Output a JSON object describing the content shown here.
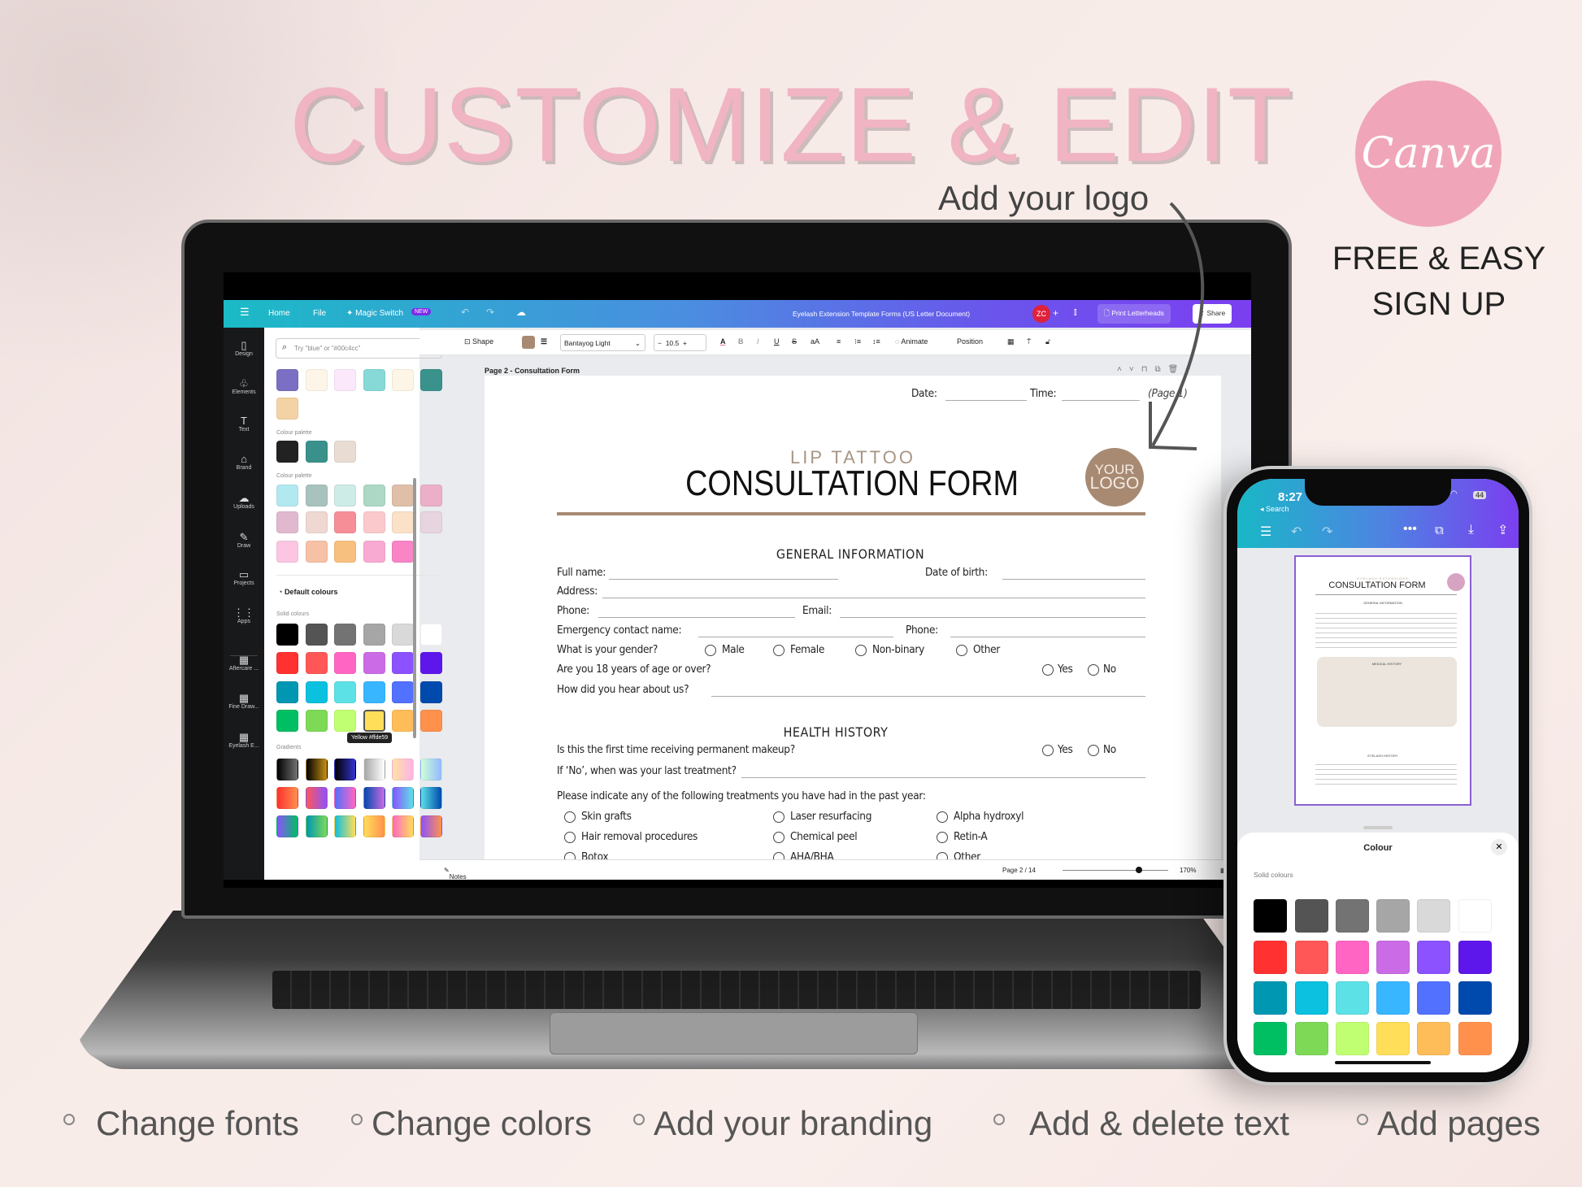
{
  "hero": {
    "title": "CUSTOMIZE & EDIT",
    "add_logo": "Add your logo",
    "canva_logo": "Canva",
    "free_line1": "FREE & EASY",
    "free_line2": "SIGN UP"
  },
  "features": [
    "Change fonts",
    "Change colors",
    "Add your branding",
    "Add & delete text",
    "Add pages"
  ],
  "canva": {
    "topbar": {
      "menu_icon": "hamburger-icon",
      "home": "Home",
      "file": "File",
      "magic_switch": "Magic Switch",
      "new_badge": "NEW",
      "doc_title": "Eyelash Extension Template Forms (US Letter Document)",
      "avatar": "ZC",
      "avatar_color": "#e0213a",
      "print": "Print Letterheads",
      "share": "Share"
    },
    "nav": [
      {
        "label": "Design",
        "icon": "▯"
      },
      {
        "label": "Elements",
        "icon": "♧"
      },
      {
        "label": "Text",
        "icon": "T"
      },
      {
        "label": "Brand",
        "icon": "⌂"
      },
      {
        "label": "Uploads",
        "icon": "☁"
      },
      {
        "label": "Draw",
        "icon": "✎"
      },
      {
        "label": "Projects",
        "icon": "▭"
      },
      {
        "label": "Apps",
        "icon": "⋮⋮"
      },
      {
        "label": "Aftercare ...",
        "icon": "▦"
      },
      {
        "label": "Fine Draw...",
        "icon": "▦"
      },
      {
        "label": "Eyelash E...",
        "icon": "▦"
      }
    ],
    "panel": {
      "search_placeholder": "Try \"blue\" or \"#00c4cc\"",
      "pastel": [
        "#7b6fc4",
        "#fdf6e8",
        "#fce8fb",
        "#86d9d7",
        "#fdf6e6",
        "#3a928c",
        "#f3d3a3"
      ],
      "palette_label": "Colour palette",
      "palette1": [
        "#222222",
        "#3a918c",
        "#e9dcd2"
      ],
      "palette2": [
        "#b2e8ef",
        "#a8c3bd",
        "#cdebe7",
        "#acd8c5",
        "#dfbfa8",
        "#ecafc8",
        "#e0b9cf",
        "#efd7d2",
        "#f68e98",
        "#fbc9cc",
        "#fae1c7",
        "#e6d5df",
        "#fcc6e2",
        "#f7c1a5",
        "#f8c07e",
        "#f9aad3",
        "#f985c7"
      ],
      "default_colours": "Default colours",
      "solid_label": "Solid colours",
      "solid": [
        "#000000",
        "#545454",
        "#737373",
        "#a6a6a6",
        "#d9d9d9",
        "#ffffff",
        "#ff3131",
        "#ff5757",
        "#ff66c4",
        "#cb6ce6",
        "#8c52ff",
        "#5e17eb",
        "#0097b2",
        "#0cc0df",
        "#5ce1e6",
        "#38b6ff",
        "#5271ff",
        "#004aad",
        "#00bf63",
        "#7ed957",
        "#c1ff72",
        "#ffde59",
        "#ffbd59",
        "#ff914d"
      ],
      "selected_solid": "#ffde59",
      "tooltip": "Yellow #ffde59",
      "gradients_label": "Gradients",
      "gradients": [
        [
          "#000000",
          "#737373"
        ],
        [
          "#000000",
          "#c89116"
        ],
        [
          "#000000",
          "#3533cd"
        ],
        [
          "#a6a6a6",
          "#ffffff"
        ],
        [
          "#ffe3a3",
          "#fdb2e8"
        ],
        [
          "#cdffd8",
          "#94b9ff"
        ],
        [
          "#ff3131",
          "#ff914d"
        ],
        [
          "#ff5757",
          "#8c52ff"
        ],
        [
          "#5170ff",
          "#ff66c4"
        ],
        [
          "#004aad",
          "#cb6ce6"
        ],
        [
          "#8c52ff",
          "#5ce1e6"
        ],
        [
          "#5ce1e6",
          "#004aad"
        ],
        [
          "#8c52ff",
          "#00bf63"
        ],
        [
          "#0097b2",
          "#7ed957"
        ],
        [
          "#0cc0df",
          "#ffde59"
        ],
        [
          "#ffde59",
          "#ff914d"
        ],
        [
          "#ff66c4",
          "#ffde59"
        ],
        [
          "#8c52ff",
          "#ff914d"
        ]
      ]
    },
    "toolbar": {
      "shape": "Shape",
      "fill_color": "#a88a73",
      "font": "Bantayog Light",
      "font_size": "10.5",
      "animate": "Animate",
      "position": "Position"
    },
    "page_label": "Page 2 - Consultation Form",
    "doc": {
      "date": "Date:",
      "time": "Time:",
      "page_ref": "(Page 1)",
      "subtitle": "LIP TATTOO",
      "title": "CONSULTATION FORM",
      "logo_top": "YOUR",
      "logo_bottom": "LOGO",
      "accent": "#a88a73",
      "general": "GENERAL INFORMATION",
      "full_name": "Full name:",
      "dob": "Date of birth:",
      "address": "Address:",
      "phone": "Phone:",
      "email": "Email:",
      "emergency": "Emergency contact name:",
      "phone2": "Phone:",
      "gender_q": "What is your gender?",
      "gender_opts": [
        "Male",
        "Female",
        "Non-binary",
        "Other"
      ],
      "age_q": "Are you 18 years of age or over?",
      "yes": "Yes",
      "no": "No",
      "hear_q": "How did you hear about us?",
      "health": "HEALTH HISTORY",
      "first_q": "Is this the first time receiving permanent makeup?",
      "last_q": "If ‘No’, when was your last treatment?",
      "treat_q": "Please indicate any of the following treatments you have had in the past year:",
      "treatments": [
        [
          "Skin grafts",
          "Laser resurfacing",
          "Alpha hydroxyl"
        ],
        [
          "Hair removal procedures",
          "Chemical peel",
          "Retin-A"
        ],
        [
          "Botox",
          "AHA/BHA",
          "Other"
        ]
      ]
    },
    "bottom": {
      "notes": "Notes",
      "page": "Page 2 / 14",
      "zoom": "170%",
      "zoom_level": 0.72
    }
  },
  "phone": {
    "time": "8:27",
    "back": "◂ Search",
    "battery": "44",
    "thumb": {
      "subtitle": "EYELASH EXTENSIONS",
      "title": "CONSULTATION FORM",
      "general": "GENERAL INFORMATION",
      "medical": "MEDICAL HISTORY",
      "eyelash": "EYELASH HISTORY"
    },
    "sheet_title": "Colour",
    "solid_label": "Solid colours",
    "solid": [
      "#000000",
      "#545454",
      "#737373",
      "#a6a6a6",
      "#d9d9d9",
      "#ffffff",
      "#ff3131",
      "#ff5757",
      "#ff66c4",
      "#cb6ce6",
      "#8c52ff",
      "#5e17eb",
      "#0097b2",
      "#0cc0df",
      "#5ce1e6",
      "#38b6ff",
      "#5271ff",
      "#004aad",
      "#00bf63",
      "#7ed957",
      "#c1ff72",
      "#ffde59",
      "#ffbd59",
      "#ff914d"
    ]
  }
}
